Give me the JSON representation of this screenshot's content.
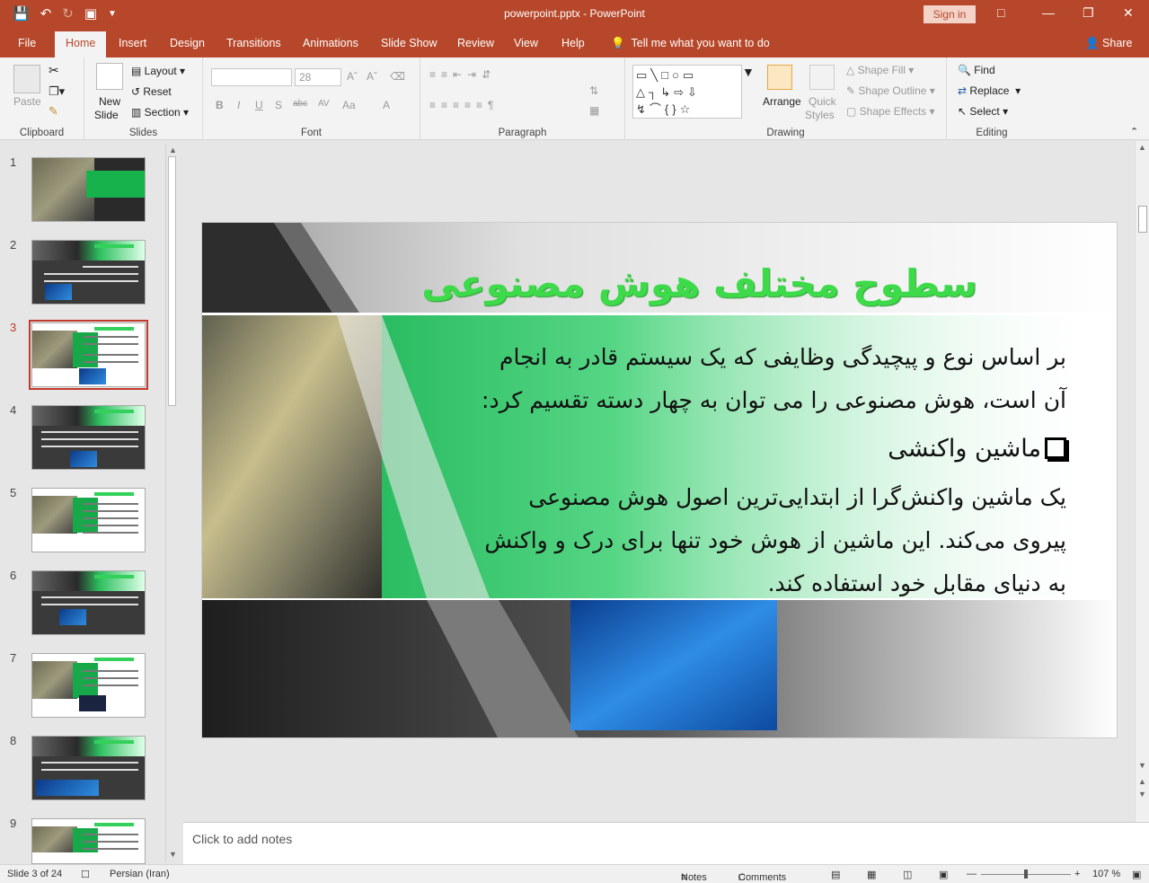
{
  "window": {
    "title": "powerpoint.pptx  -  PowerPoint",
    "signin": "Sign in"
  },
  "tabs": [
    "File",
    "Home",
    "Insert",
    "Design",
    "Transitions",
    "Animations",
    "Slide Show",
    "Review",
    "View",
    "Help"
  ],
  "active_tab": "Home",
  "tell_me": "Tell me what you want to do",
  "share": "Share",
  "ribbon": {
    "clipboard": {
      "label": "Clipboard",
      "paste": "Paste"
    },
    "slides": {
      "label": "Slides",
      "new_slide_1": "New",
      "new_slide_2": "Slide",
      "layout": "Layout",
      "reset": "Reset",
      "section": "Section"
    },
    "font": {
      "label": "Font",
      "size": "28",
      "bold": "B",
      "italic": "I",
      "underline": "U",
      "shadow": "S",
      "strike": "abc",
      "spacing": "AV",
      "case": "Aa",
      "color": "A"
    },
    "paragraph": {
      "label": "Paragraph"
    },
    "drawing": {
      "label": "Drawing",
      "arrange": "Arrange",
      "quick_styles_1": "Quick",
      "quick_styles_2": "Styles",
      "shape_fill": "Shape Fill",
      "shape_outline": "Shape Outline",
      "shape_effects": "Shape Effects"
    },
    "editing": {
      "label": "Editing",
      "find": "Find",
      "replace": "Replace",
      "select": "Select"
    }
  },
  "thumbnails": [
    "1",
    "2",
    "3",
    "4",
    "5",
    "6",
    "7",
    "8",
    "9"
  ],
  "selected_slide": 3,
  "slide": {
    "title": "سطوح مختلف هوش مصنوعی",
    "body_lines": [
      "بر اساس نوع و پیچیدگی وظایفی که یک سیستم قادر به انجام",
      "آن است، هوش مصنوعی را می توان به چهار دسته تقسیم کرد:"
    ],
    "bullet": "ماشین واکنشی",
    "para_lines": [
      "یک ماشین واکنش‌گرا از ابتدایی‌ترین اصول هوش مصنوعی",
      "پیروی می‌کند. این ماشین از هوش خود تنها برای درک و واکنش",
      "به دنیای مقابل خود استفاده کند."
    ]
  },
  "notes_placeholder": "Click to add notes",
  "status": {
    "slide_info": "Slide 3 of 24",
    "language": "Persian (Iran)",
    "notes": "Notes",
    "comments": "Comments",
    "zoom": "107 %"
  },
  "colors": {
    "titlebar": "#b7472a",
    "slide_title": "#3ddb4a",
    "accent_green": "#17b24c",
    "selection": "#c0392b"
  }
}
